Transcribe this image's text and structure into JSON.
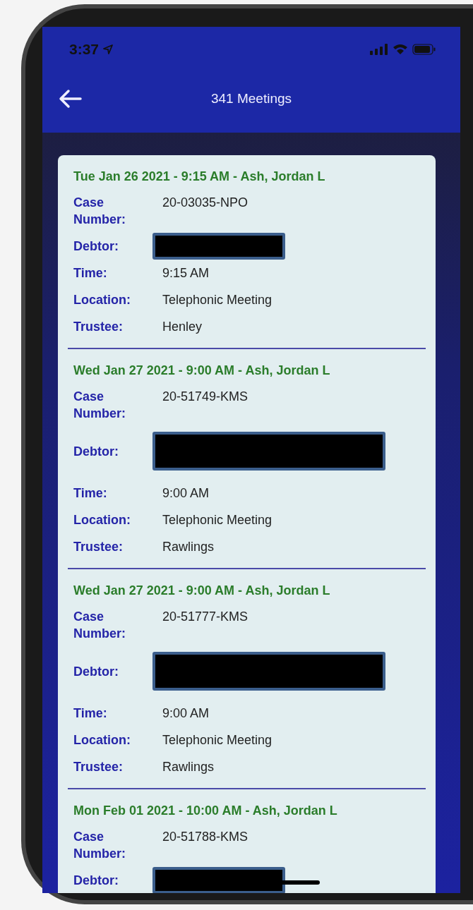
{
  "status_bar": {
    "time": "3:37"
  },
  "header": {
    "title": "341 Meetings"
  },
  "meetings": [
    {
      "heading": "Tue Jan 26 2021 - 9:15 AM - Ash, Jordan L",
      "fields": [
        {
          "kind": "text",
          "label": "Case Number:",
          "value": "20-03035-NPO"
        },
        {
          "kind": "redacted",
          "label": "Debtor:",
          "tall": false
        },
        {
          "kind": "text",
          "label": "Time:",
          "value": "9:15 AM"
        },
        {
          "kind": "text",
          "label": "Location:",
          "value": "Telephonic Meeting"
        },
        {
          "kind": "text",
          "label": "Trustee:",
          "value": "Henley"
        }
      ]
    },
    {
      "heading": "Wed Jan 27 2021 - 9:00 AM - Ash, Jordan L",
      "fields": [
        {
          "kind": "text",
          "label": "Case Number:",
          "value": "20-51749-KMS"
        },
        {
          "kind": "redacted",
          "label": "Debtor:",
          "tall": true
        },
        {
          "kind": "text",
          "label": "Time:",
          "value": "9:00 AM"
        },
        {
          "kind": "text",
          "label": "Location:",
          "value": "Telephonic Meeting"
        },
        {
          "kind": "text",
          "label": "Trustee:",
          "value": "Rawlings"
        }
      ]
    },
    {
      "heading": "Wed Jan 27 2021 - 9:00 AM - Ash, Jordan L",
      "fields": [
        {
          "kind": "text",
          "label": "Case Number:",
          "value": "20-51777-KMS"
        },
        {
          "kind": "redacted",
          "label": "Debtor:",
          "tall": true
        },
        {
          "kind": "text",
          "label": "Time:",
          "value": "9:00 AM"
        },
        {
          "kind": "text",
          "label": "Location:",
          "value": "Telephonic Meeting"
        },
        {
          "kind": "text",
          "label": "Trustee:",
          "value": "Rawlings"
        }
      ]
    },
    {
      "heading": "Mon Feb 01 2021 - 10:00 AM - Ash, Jordan L",
      "fields": [
        {
          "kind": "text",
          "label": "Case Number:",
          "value": "20-51788-KMS"
        },
        {
          "kind": "redacted",
          "label": "Debtor:",
          "tall": false
        }
      ]
    }
  ]
}
